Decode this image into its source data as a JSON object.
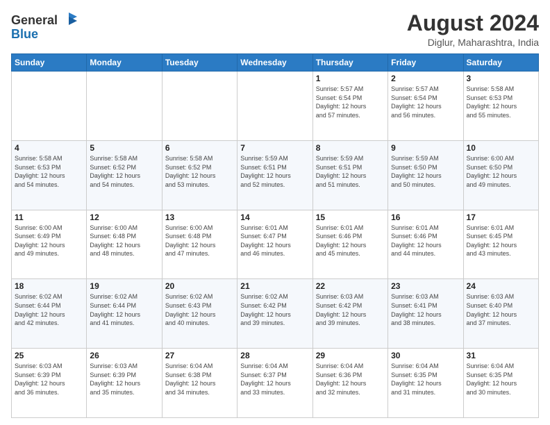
{
  "header": {
    "logo_line1": "General",
    "logo_line2": "Blue",
    "month_year": "August 2024",
    "location": "Diglur, Maharashtra, India"
  },
  "days_of_week": [
    "Sunday",
    "Monday",
    "Tuesday",
    "Wednesday",
    "Thursday",
    "Friday",
    "Saturday"
  ],
  "weeks": [
    [
      {
        "day": "",
        "info": ""
      },
      {
        "day": "",
        "info": ""
      },
      {
        "day": "",
        "info": ""
      },
      {
        "day": "",
        "info": ""
      },
      {
        "day": "1",
        "info": "Sunrise: 5:57 AM\nSunset: 6:54 PM\nDaylight: 12 hours\nand 57 minutes."
      },
      {
        "day": "2",
        "info": "Sunrise: 5:57 AM\nSunset: 6:54 PM\nDaylight: 12 hours\nand 56 minutes."
      },
      {
        "day": "3",
        "info": "Sunrise: 5:58 AM\nSunset: 6:53 PM\nDaylight: 12 hours\nand 55 minutes."
      }
    ],
    [
      {
        "day": "4",
        "info": "Sunrise: 5:58 AM\nSunset: 6:53 PM\nDaylight: 12 hours\nand 54 minutes."
      },
      {
        "day": "5",
        "info": "Sunrise: 5:58 AM\nSunset: 6:52 PM\nDaylight: 12 hours\nand 54 minutes."
      },
      {
        "day": "6",
        "info": "Sunrise: 5:58 AM\nSunset: 6:52 PM\nDaylight: 12 hours\nand 53 minutes."
      },
      {
        "day": "7",
        "info": "Sunrise: 5:59 AM\nSunset: 6:51 PM\nDaylight: 12 hours\nand 52 minutes."
      },
      {
        "day": "8",
        "info": "Sunrise: 5:59 AM\nSunset: 6:51 PM\nDaylight: 12 hours\nand 51 minutes."
      },
      {
        "day": "9",
        "info": "Sunrise: 5:59 AM\nSunset: 6:50 PM\nDaylight: 12 hours\nand 50 minutes."
      },
      {
        "day": "10",
        "info": "Sunrise: 6:00 AM\nSunset: 6:50 PM\nDaylight: 12 hours\nand 49 minutes."
      }
    ],
    [
      {
        "day": "11",
        "info": "Sunrise: 6:00 AM\nSunset: 6:49 PM\nDaylight: 12 hours\nand 49 minutes."
      },
      {
        "day": "12",
        "info": "Sunrise: 6:00 AM\nSunset: 6:48 PM\nDaylight: 12 hours\nand 48 minutes."
      },
      {
        "day": "13",
        "info": "Sunrise: 6:00 AM\nSunset: 6:48 PM\nDaylight: 12 hours\nand 47 minutes."
      },
      {
        "day": "14",
        "info": "Sunrise: 6:01 AM\nSunset: 6:47 PM\nDaylight: 12 hours\nand 46 minutes."
      },
      {
        "day": "15",
        "info": "Sunrise: 6:01 AM\nSunset: 6:46 PM\nDaylight: 12 hours\nand 45 minutes."
      },
      {
        "day": "16",
        "info": "Sunrise: 6:01 AM\nSunset: 6:46 PM\nDaylight: 12 hours\nand 44 minutes."
      },
      {
        "day": "17",
        "info": "Sunrise: 6:01 AM\nSunset: 6:45 PM\nDaylight: 12 hours\nand 43 minutes."
      }
    ],
    [
      {
        "day": "18",
        "info": "Sunrise: 6:02 AM\nSunset: 6:44 PM\nDaylight: 12 hours\nand 42 minutes."
      },
      {
        "day": "19",
        "info": "Sunrise: 6:02 AM\nSunset: 6:44 PM\nDaylight: 12 hours\nand 41 minutes."
      },
      {
        "day": "20",
        "info": "Sunrise: 6:02 AM\nSunset: 6:43 PM\nDaylight: 12 hours\nand 40 minutes."
      },
      {
        "day": "21",
        "info": "Sunrise: 6:02 AM\nSunset: 6:42 PM\nDaylight: 12 hours\nand 39 minutes."
      },
      {
        "day": "22",
        "info": "Sunrise: 6:03 AM\nSunset: 6:42 PM\nDaylight: 12 hours\nand 39 minutes."
      },
      {
        "day": "23",
        "info": "Sunrise: 6:03 AM\nSunset: 6:41 PM\nDaylight: 12 hours\nand 38 minutes."
      },
      {
        "day": "24",
        "info": "Sunrise: 6:03 AM\nSunset: 6:40 PM\nDaylight: 12 hours\nand 37 minutes."
      }
    ],
    [
      {
        "day": "25",
        "info": "Sunrise: 6:03 AM\nSunset: 6:39 PM\nDaylight: 12 hours\nand 36 minutes."
      },
      {
        "day": "26",
        "info": "Sunrise: 6:03 AM\nSunset: 6:39 PM\nDaylight: 12 hours\nand 35 minutes."
      },
      {
        "day": "27",
        "info": "Sunrise: 6:04 AM\nSunset: 6:38 PM\nDaylight: 12 hours\nand 34 minutes."
      },
      {
        "day": "28",
        "info": "Sunrise: 6:04 AM\nSunset: 6:37 PM\nDaylight: 12 hours\nand 33 minutes."
      },
      {
        "day": "29",
        "info": "Sunrise: 6:04 AM\nSunset: 6:36 PM\nDaylight: 12 hours\nand 32 minutes."
      },
      {
        "day": "30",
        "info": "Sunrise: 6:04 AM\nSunset: 6:35 PM\nDaylight: 12 hours\nand 31 minutes."
      },
      {
        "day": "31",
        "info": "Sunrise: 6:04 AM\nSunset: 6:35 PM\nDaylight: 12 hours\nand 30 minutes."
      }
    ]
  ]
}
